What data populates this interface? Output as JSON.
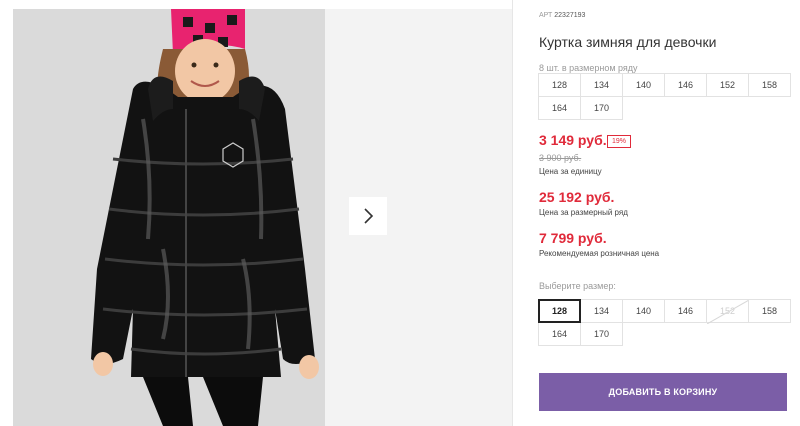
{
  "product": {
    "art_label": "АРТ",
    "art_number": "22327193",
    "title": "Куртка зимняя для девочки",
    "pack_caption": "8 шт. в размерном ряду",
    "pack_sizes": [
      "128",
      "134",
      "140",
      "146",
      "152",
      "158",
      "164",
      "170"
    ]
  },
  "pricing": {
    "price": "3 149 руб.",
    "discount": "19%",
    "old_price": "3 900 руб.",
    "unit_caption": "Цена за единицу",
    "row_price": "25 192 руб.",
    "row_caption": "Цена за размерный ряд",
    "rrp": "7 799 руб.",
    "rrp_caption": "Рекомендуемая розничная цена"
  },
  "size_select": {
    "caption": "Выберите размер:",
    "options": [
      {
        "label": "128",
        "state": "selected"
      },
      {
        "label": "134",
        "state": "available"
      },
      {
        "label": "140",
        "state": "available"
      },
      {
        "label": "146",
        "state": "available"
      },
      {
        "label": "152",
        "state": "disabled"
      },
      {
        "label": "158",
        "state": "available"
      },
      {
        "label": "164",
        "state": "available"
      },
      {
        "label": "170",
        "state": "available"
      }
    ]
  },
  "cart": {
    "add_label": "ДОБАВИТЬ В КОРЗИНУ"
  },
  "gallery": {
    "next_icon": "chevron-right-icon"
  },
  "colors": {
    "accent_red": "#e02a3a",
    "button_purple": "#7b5ea7"
  }
}
